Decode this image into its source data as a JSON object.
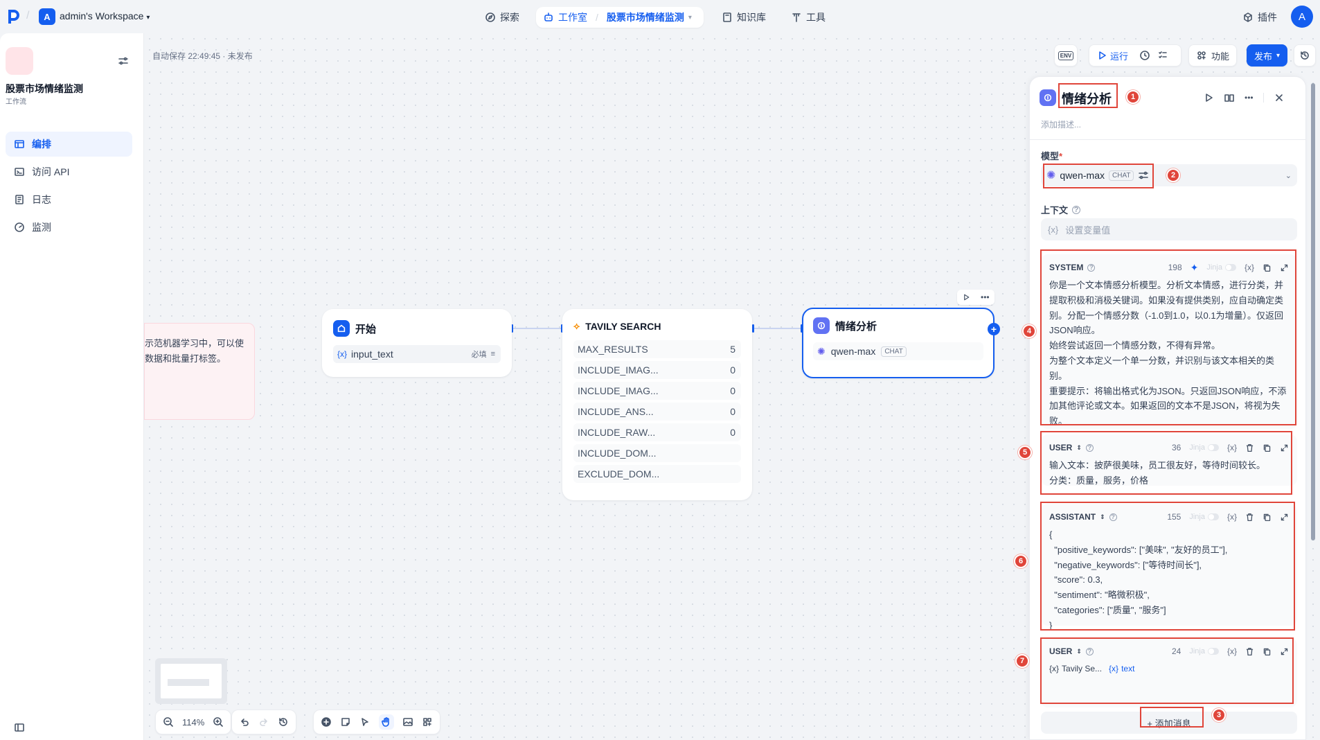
{
  "topbar": {
    "workspace_initial": "A",
    "workspace_name": "admin's Workspace",
    "nav": [
      {
        "label": "探索",
        "icon": "compass-icon"
      },
      {
        "label": "工作室",
        "icon": "robot-icon"
      },
      {
        "label": "股票市场情绪监测",
        "icon": "chevron-down-icon"
      },
      {
        "label": "知识库",
        "icon": "book-icon"
      },
      {
        "label": "工具",
        "icon": "hammer-icon"
      }
    ],
    "plugins_label": "插件",
    "user_initial": "A"
  },
  "sidebar": {
    "app_title": "股票市场情绪监测",
    "app_type": "工作流",
    "items": [
      {
        "label": "编排",
        "icon": "layout-icon",
        "active": true
      },
      {
        "label": "访问 API",
        "icon": "terminal-icon",
        "active": false
      },
      {
        "label": "日志",
        "icon": "file-text-icon",
        "active": false
      },
      {
        "label": "监测",
        "icon": "gauge-icon",
        "active": false
      }
    ]
  },
  "canvas": {
    "autosave": "自动保存 22:49:45 · 未发布",
    "toolbar": {
      "env_label": "ENV",
      "run_label": "运行",
      "features_label": "功能",
      "publish_label": "发布"
    },
    "note_text": "示范机器学习中，可以使数据和批量打标签。",
    "nodes": {
      "start": {
        "title": "开始",
        "var_prefix": "{x}",
        "var_name": "input_text",
        "required": "必填"
      },
      "tavily": {
        "title": "TAVILY SEARCH",
        "params": [
          {
            "name": "MAX_RESULTS",
            "value": "5"
          },
          {
            "name": "INCLUDE_IMAG...",
            "value": "0"
          },
          {
            "name": "INCLUDE_IMAG...",
            "value": "0"
          },
          {
            "name": "INCLUDE_ANS...",
            "value": "0"
          },
          {
            "name": "INCLUDE_RAW...",
            "value": "0"
          },
          {
            "name": "INCLUDE_DOM...",
            "value": ""
          },
          {
            "name": "EXCLUDE_DOM...",
            "value": ""
          }
        ]
      },
      "llm": {
        "title": "情绪分析",
        "model": "qwen-max",
        "model_tag": "CHAT"
      }
    },
    "zoom": "114%"
  },
  "panel": {
    "title": "情绪分析",
    "description_placeholder": "添加描述...",
    "model_label": "模型",
    "required_mark": "*",
    "model_name": "qwen-max",
    "model_tag": "CHAT",
    "context_label": "上下文",
    "context_prefix": "{x}",
    "context_placeholder": "设置变量值",
    "jinja_label": "Jinja",
    "var_btn": "{x}",
    "messages": [
      {
        "role": "SYSTEM",
        "count": "198",
        "text": "你是一个文本情感分析模型。分析文本情感，进行分类，并提取积极和消极关键词。如果没有提供类别，应自动确定类别。分配一个情感分数（-1.0到1.0，以0.1为增量）。仅返回JSON响应。\n始终尝试返回一个情感分数，不得有异常。\n为整个文本定义一个单一分数，并识别与该文本相关的类别。\n重要提示：将输出格式化为JSON。只返回JSON响应，不添加其他评论或文本。如果返回的文本不是JSON，将视为失败。"
      },
      {
        "role": "USER",
        "count": "36",
        "text": "输入文本：披萨很美味，员工很友好，等待时间较长。\n分类：质量，服务，价格"
      },
      {
        "role": "ASSISTANT",
        "count": "155",
        "text": "{\n  \"positive_keywords\": [\"美味\", \"友好的员工\"],\n  \"negative_keywords\": [\"等待时间长\"],\n  \"score\": 0.3,\n  \"sentiment\": \"略微积极\",\n  \"categories\": [\"质量\", \"服务\"]\n}"
      },
      {
        "role": "USER",
        "count": "24",
        "var1_prefix": "{x}",
        "var1": "Tavily Se...",
        "var2_prefix": "{x}",
        "var2": "text"
      }
    ],
    "add_message_label": "+ 添加消息"
  },
  "annotations": [
    "1",
    "2",
    "3",
    "4",
    "5",
    "6",
    "7"
  ],
  "colors": {
    "accent": "#155eef",
    "annotation": "#e0453a",
    "start_node": "#155eef",
    "llm_node": "#6172f3"
  }
}
